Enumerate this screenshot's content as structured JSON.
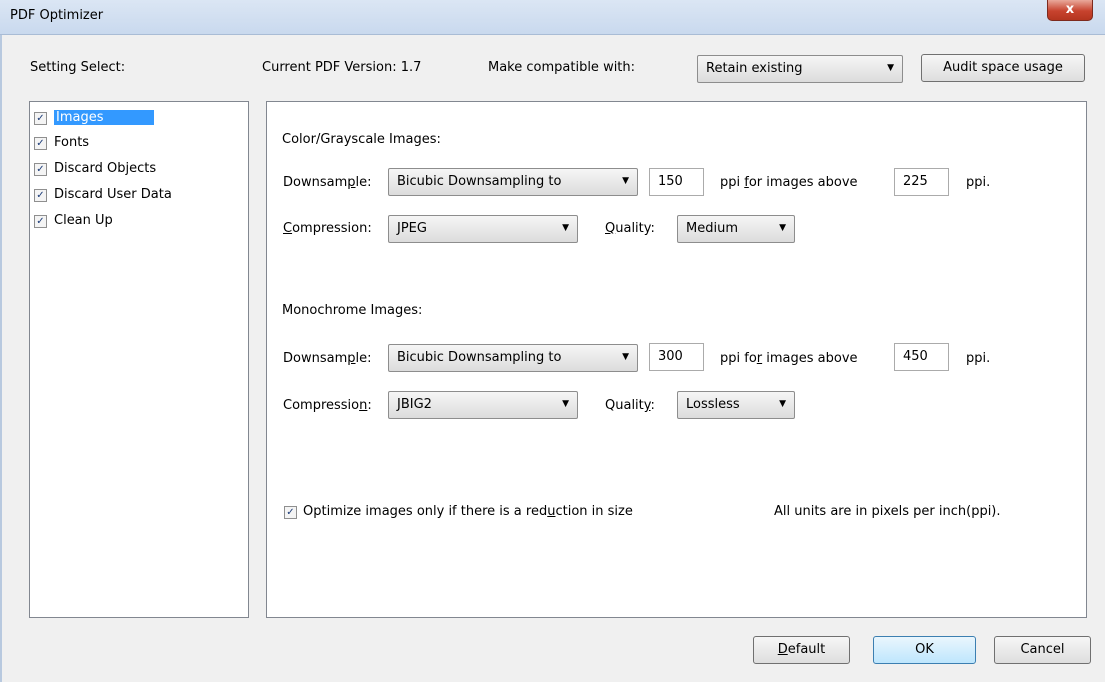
{
  "window": {
    "title": "PDF Optimizer",
    "close_glyph": "x"
  },
  "header": {
    "setting_select_label": "Setting Select:",
    "pdf_version_label": "Current PDF Version: 1.7",
    "compat_label": "Make compatible with:",
    "compat_value": "Retain existing",
    "audit_button": "Audit space usage"
  },
  "sidebar": {
    "items": [
      {
        "label": "Images",
        "checked": true,
        "selected": true
      },
      {
        "label": "Fonts",
        "checked": true
      },
      {
        "label": "Discard Objects",
        "checked": true
      },
      {
        "label": "Discard User Data",
        "checked": true
      },
      {
        "label": "Clean Up",
        "checked": true
      }
    ]
  },
  "color_images": {
    "heading": "Color/Grayscale Images:",
    "downsample_label_pre": "Downsam",
    "downsample_label_key": "p",
    "downsample_label_post": "le:",
    "downsample_value": "Bicubic Downsampling to",
    "ppi_value": "150",
    "ppi_above_pre": "ppi ",
    "ppi_above_key": "f",
    "ppi_above_post": "or images above",
    "above_value": "225",
    "ppi_suffix": "ppi.",
    "compression_label_key": "C",
    "compression_label_post": "ompression:",
    "compression_value": "JPEG",
    "quality_label_key": "Q",
    "quality_label_post": "uality:",
    "quality_value": "Medium"
  },
  "mono_images": {
    "heading": "Monochrome Images:",
    "downsample_label_pre": "Downsam",
    "downsample_label_key": "p",
    "downsample_label_post": "le:",
    "downsample_value": "Bicubic Downsampling to",
    "ppi_value": "300",
    "ppi_above_pre": "ppi fo",
    "ppi_above_key": "r",
    "ppi_above_post": " images above",
    "above_value": "450",
    "ppi_suffix": "ppi.",
    "compression_label_pre": "Compressio",
    "compression_label_key": "n",
    "compression_label_post": ":",
    "compression_value": "JBIG2",
    "quality_label_pre": "Qualit",
    "quality_label_key": "y",
    "quality_label_post": ":",
    "quality_value": "Lossless"
  },
  "footer_options": {
    "optimize_pre": "Optimize images only if there is a red",
    "optimize_key": "u",
    "optimize_post": "ction in size",
    "optimize_checked": true,
    "units_note": "All units are in pixels per inch(ppi)."
  },
  "buttons": {
    "default_key": "D",
    "default_post": "efault",
    "ok": "OK",
    "cancel": "Cancel"
  },
  "icons": {
    "checkmark": "✓",
    "dropdown_arrow": "▼"
  }
}
